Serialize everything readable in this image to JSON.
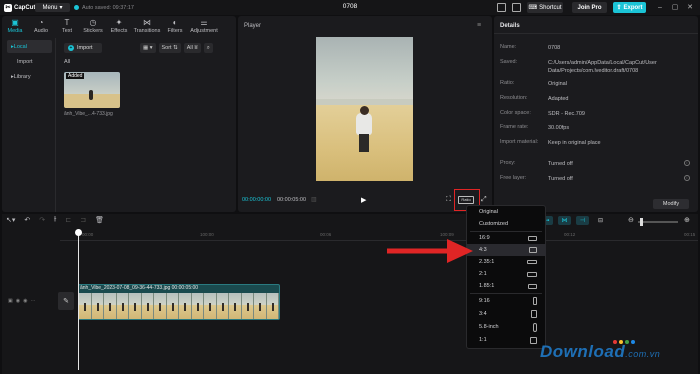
{
  "app": {
    "logo_text": "CapCut",
    "menu_label": "Menu",
    "autosave_text": "Auto saved: 09:37:17",
    "project_title": "0708",
    "shortcut_label": "Shortcut",
    "joinpro_label": "Join Pro",
    "export_label": "Export"
  },
  "media": {
    "tabs": [
      {
        "label": "Media",
        "icon": "media-icon"
      },
      {
        "label": "Audio",
        "icon": "audio-icon"
      },
      {
        "label": "Text",
        "icon": "text-icon"
      },
      {
        "label": "Stickers",
        "icon": "stickers-icon"
      },
      {
        "label": "Effects",
        "icon": "effects-icon"
      },
      {
        "label": "Transitions",
        "icon": "transitions-icon"
      },
      {
        "label": "Filters",
        "icon": "filters-icon"
      },
      {
        "label": "Adjustment",
        "icon": "adjustment-icon"
      }
    ],
    "sidebar": [
      "Local",
      "Import",
      "Library"
    ],
    "import_label": "Import",
    "sort_label": "Sort",
    "all_filter_label": "All",
    "all_heading": "All",
    "added_tag": "Added",
    "thumb_name": "ânh_Vibe_...4-733.jpg"
  },
  "player": {
    "label": "Player",
    "time_current": "00:00:00:00",
    "time_total": "00:00:05:00",
    "ratio_label": "Ratio"
  },
  "details": {
    "title": "Details",
    "rows": [
      {
        "k": "Name:",
        "v": "0708"
      },
      {
        "k": "Saved:",
        "v": "C:/Users/admin/AppData/Local/CapCut/User Data/Projects/com.lveditor.draft/0708"
      },
      {
        "k": "Ratio:",
        "v": "Original"
      },
      {
        "k": "Resolution:",
        "v": "Adapted"
      },
      {
        "k": "Color space:",
        "v": "SDR - Rec.709"
      },
      {
        "k": "Frame rate:",
        "v": "30.00fps"
      },
      {
        "k": "Import material:",
        "v": "Keep in original place"
      },
      {
        "k": "Proxy:",
        "v": "Turned off"
      },
      {
        "k": "Free layer:",
        "v": "Turned off"
      }
    ],
    "modify_label": "Modify"
  },
  "timeline": {
    "ticks": [
      "00:00",
      "100:00",
      "00:06",
      "100:09",
      "00:12",
      "00:15"
    ],
    "clip_name": "ânh_Vibe_2023-07-08_09-36-44-733.jpg 00:00:05:00"
  },
  "ratio_menu": {
    "options": [
      "Original",
      "Customized",
      "16:9",
      "4:3",
      "2.35:1",
      "2:1",
      "1.85:1",
      "9:16",
      "3:4",
      "5.8-inch",
      "1:1"
    ],
    "selected": "4:3"
  },
  "watermark": {
    "text": "Download",
    "suffix": ".com.vn"
  },
  "colors": {
    "accent": "#1bc4d6",
    "highlight": "#e02525",
    "panel": "#1b1b1e"
  }
}
